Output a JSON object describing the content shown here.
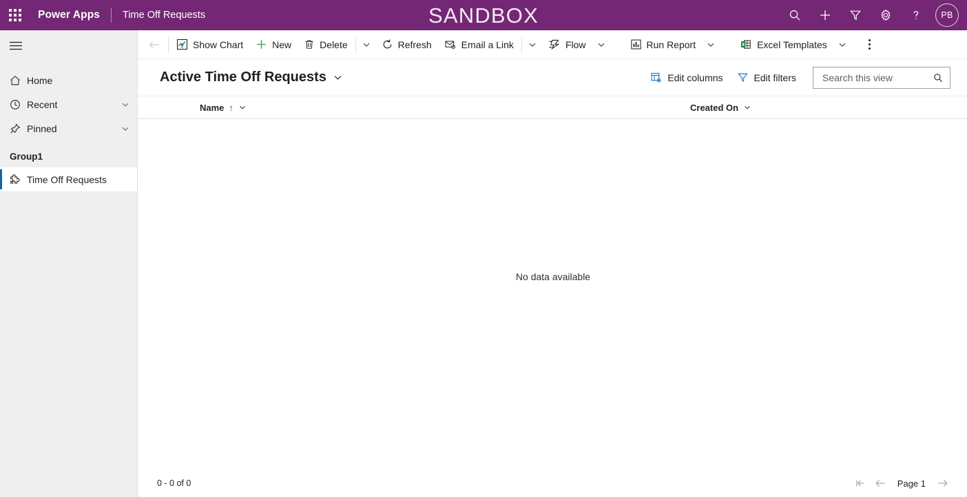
{
  "header": {
    "waffle_name": "app-launcher-icon",
    "brand": "Power Apps",
    "app_name": "Time Off Requests",
    "environment_banner": "SANDBOX",
    "icons": [
      {
        "name": "search-icon",
        "label": "Search"
      },
      {
        "name": "plus-icon",
        "label": "New"
      },
      {
        "name": "filter-icon",
        "label": "Filter"
      },
      {
        "name": "gear-icon",
        "label": "Settings"
      },
      {
        "name": "help-icon",
        "label": "Help"
      }
    ],
    "avatar_initials": "PB",
    "accent_color": "#742774"
  },
  "sidebar": {
    "hamburger_label": "Site map",
    "items": [
      {
        "label": "Home",
        "icon": "home-icon",
        "has_chevron": false
      },
      {
        "label": "Recent",
        "icon": "clock-icon",
        "has_chevron": true
      },
      {
        "label": "Pinned",
        "icon": "pin-icon",
        "has_chevron": true
      }
    ],
    "group_label": "Group1",
    "entities": [
      {
        "label": "Time Off Requests",
        "icon": "entity-icon",
        "selected": true
      }
    ],
    "selected_indicator_color": "#1264a3",
    "background_color": "#f0eff0"
  },
  "commandbar": {
    "back_label": "Back",
    "commands": [
      {
        "label": "Show Chart",
        "icon": "show-chart-icon",
        "caret": false
      },
      {
        "label": "New",
        "icon": "plus-icon",
        "caret": false
      },
      {
        "label": "Delete",
        "icon": "trash-icon",
        "caret": true
      },
      {
        "label": "Refresh",
        "icon": "refresh-icon",
        "caret": false
      },
      {
        "label": "Email a Link",
        "icon": "email-link-icon",
        "caret": true
      },
      {
        "label": "Flow",
        "icon": "flow-icon",
        "caret": true
      },
      {
        "label": "Run Report",
        "icon": "report-icon",
        "caret": true
      },
      {
        "label": "Excel Templates",
        "icon": "excel-icon",
        "caret": true
      }
    ],
    "overflow_label": "More commands"
  },
  "view": {
    "title": "Active Time Off Requests",
    "edit_columns_label": "Edit columns",
    "edit_filters_label": "Edit filters",
    "search_placeholder": "Search this view",
    "search_value": ""
  },
  "grid": {
    "columns": [
      {
        "label": "Name",
        "sorted": "asc",
        "sort_glyph": "↑"
      },
      {
        "label": "Created On",
        "sorted": "none",
        "sort_glyph": ""
      }
    ],
    "rows": [],
    "empty_message": "No data available"
  },
  "footer": {
    "record_count": "0 - 0 of 0",
    "page_label": "Page 1",
    "first_page_label": "First page",
    "previous_page_label": "Previous page",
    "next_page_label": "Next page"
  }
}
